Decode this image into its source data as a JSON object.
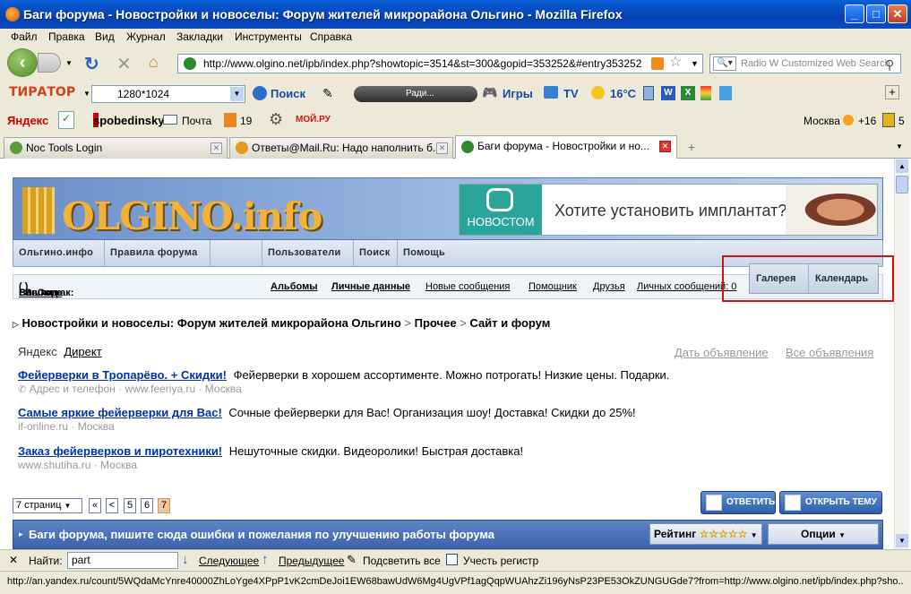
{
  "window": {
    "title": "Баги форума - Новостройки и новоселы: Форум жителей микрорайона Ольгино - Mozilla Firefox"
  },
  "menu": [
    "Файл",
    "Правка",
    "Вид",
    "Журнал",
    "Закладки",
    "Инструменты",
    "Справка"
  ],
  "nav": {
    "url": "http://www.olgino.net/ipb/index.php?showtopic=3514&st=300&gopid=353252&#entry353252",
    "search_placeholder": "Radio W Customized Web Search"
  },
  "toolbar1": {
    "brand": "ТИРАТОР",
    "resolution": "1280*1024",
    "search": "Поиск",
    "radio": "Ради...",
    "games": "Игры",
    "tv": "TV",
    "temp": "16°C"
  },
  "toolbar2": {
    "yandex": "Яндекс",
    "user": "spobedinsky",
    "mail": "Почта",
    "count": "19",
    "moy": "МОЙ.РУ",
    "city": "Москва",
    "weather": "+16",
    "extra": "5"
  },
  "tabs": [
    {
      "label": "Noc Tools Login"
    },
    {
      "label": "Ответы@Mail.Ru: Надо наполнить б..."
    },
    {
      "label": "Баги форума - Новостройки и но..."
    }
  ],
  "site": {
    "logo": "OLGINO.info",
    "ad": {
      "brand": "НОВОСТОМ",
      "text": "Хотите установить имплантат?"
    },
    "navrow": [
      "Ольгино.инфо",
      "Правила форума",
      "",
      "Пользователи",
      "Поиск",
      "Помощь"
    ],
    "gallery": [
      "Галерея",
      "Календарь"
    ],
    "user": {
      "logged_as": "Вошли как:",
      "name": "BanCone",
      "logout": "Выход",
      "links": [
        "Альбомы",
        "Личные данные",
        "Новые сообщения",
        "Помощник",
        "Друзья",
        "Личных сообщений: 0"
      ]
    },
    "breadcrumb": {
      "forum": "Новостройки и новоселы: Форум жителей микрорайона Ольгино",
      "sep": ">",
      "sub": "Прочее",
      "topic": "Сайт и форум"
    },
    "yandex": {
      "label": "Яндекс",
      "direct": "Директ",
      "post_ad": "Дать объявление",
      "all_ads": "Все объявления"
    },
    "ads": [
      {
        "title": "Фейерверки в Тропарёво. + Скидки!",
        "text": "Фейерверки в хорошем ассортименте. Можно потрогать! Низкие цены. Подарки.",
        "sub": "Адрес и телефон · www.feeriya.ru · Москва"
      },
      {
        "title": "Самые яркие фейерверки для Вас!",
        "text": "Сочные фейерверки для Вас! Организация шоу! Доставка! Скидки до 25%!",
        "sub": "if-online.ru · Москва"
      },
      {
        "title": "Заказ фейерверков и пиротехники!",
        "text": "Нешуточные скидки. Видеоролики! Быстрая доставка!",
        "sub": "www.shutiha.ru · Москва"
      }
    ],
    "pager": {
      "pages": "7 страниц",
      "first": "«",
      "prev": "<",
      "p5": "5",
      "p6": "6",
      "p7": "7"
    },
    "buttons": {
      "reply": "ОТВЕТИТЬ",
      "new_topic": "ОТКРЫТЬ ТЕМУ"
    },
    "forum_bar": {
      "title": "Баги форума, пишите сюда ошибки и пожелания по улучшению работы форума",
      "rating": "Рейтинг",
      "stars": "☆☆☆☆☆",
      "options": "Опции"
    }
  },
  "find": {
    "label": "Найти:",
    "value": "part",
    "next": "Следующее",
    "prev": "Предыдущее",
    "highlight": "Подсветить все",
    "match_case": "Учесть регистр"
  },
  "status": {
    "text": "http://an.yandex.ru/count/5WQdaMcYnre40000ZhLoYge4XPpP1vK2cmDeJoi1EW68bawUdW6Mg4UgVPf1agQqpWUAhzZi196yNsP23PE53OkZUNGUGde7?from=http://www.olgino.net/ipb/index.php?sho..."
  }
}
